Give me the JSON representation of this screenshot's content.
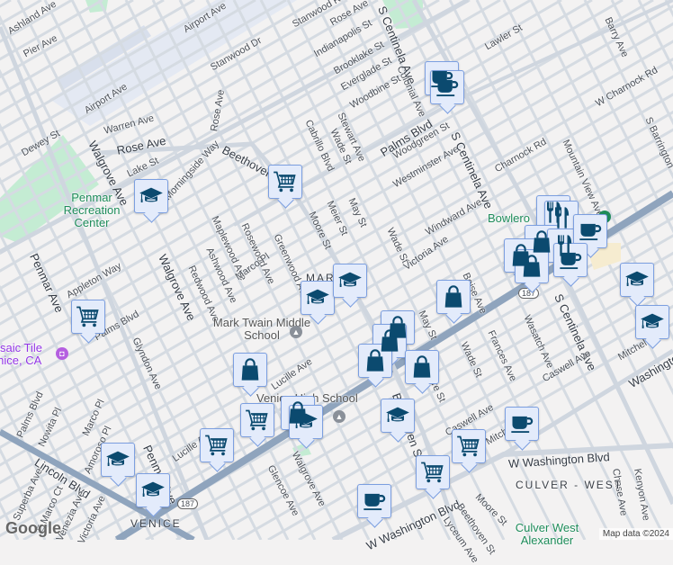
{
  "streets": [
    "Ashland Ave",
    "Pier Ave",
    "Airport Ave",
    "Airport Ave",
    "Stanwood Dr",
    "Stanwood Rd",
    "Warren Ave",
    "Dewey St",
    "Rose Ave",
    "Walgrove Ave",
    "Lake St",
    "Rose Ave",
    "Morningside Way",
    "Beethoven St",
    "Cabrillo Blvd",
    "Maplewood Ave",
    "Rosewood Ave",
    "Greenwood Ave",
    "Ashwood Ave",
    "Redwood Ave",
    "Marco Pl",
    "Meier St",
    "Moore St",
    "May St",
    "Wade St",
    "Victoria Ave",
    "Windward Ave",
    "Westminster Ave",
    "Woodgreen St",
    "Palms Blvd",
    "Charnock Rd",
    "S Centinela Ave",
    "W Charnock Rd",
    "Mountain View Ave",
    "S Barrington",
    "Barry Ave",
    "Lawler St",
    "Colonial Ave",
    "Woodbine St",
    "Everglade St",
    "Brooklake St",
    "Indianapolis St",
    "Rose Ave",
    "Stewart Ave",
    "Wade St",
    "S Centinela Ave",
    "Lucille Ave",
    "Lucille Ave",
    "Palms Blvd",
    "Appleton Way",
    "Glyndon Ave",
    "Palms Blvd",
    "Nowita Pl",
    "Marco Pl",
    "Amoroso Pl",
    "Lincoln Blvd",
    "Superba Ave",
    "E Marco Ct",
    "Venezia Ave",
    "Victoria Ave",
    "Penmar Ave",
    "Penmar Ave",
    "Glencoe Ave",
    "Walgrove Ave",
    "Walgrove Ave",
    "Beethoven St",
    "Moore St",
    "May St",
    "Wade St",
    "Frances Ave",
    "Wasatch Ave",
    "Boise Ave",
    "S Centinela Ave",
    "Caswell Ave",
    "Caswell Ave",
    "Mitchell Ave",
    "W Washington Blvd",
    "Washington Blvd",
    "W Washington Blvd",
    "Chase Ave",
    "Kenyon Ave",
    "Moore St",
    "Beethoven St",
    "Lyceum Ave",
    "Mitchell Ave"
  ],
  "places": {
    "penmar": "Penmar Recreation Center",
    "bowlero": "Bowlero",
    "twain": "Mark Twain Middle School",
    "venice_high": "Venice High School",
    "mosaic": "Mosaic Tile Venice, CA",
    "culver_park": "Culver West Alexander"
  },
  "areas": {
    "mar_vista": "MAR VISTA",
    "venice": "VENICE",
    "culver_west": "CULVER - WEST"
  },
  "shield": "187",
  "google": "Google",
  "credit": "Map data ©2024",
  "colors": {
    "marker_bg": "#e3ebfb",
    "marker_border": "#7c9fe0",
    "icon": "#0b4a6f",
    "highway": "#8fa4bd",
    "park": "#c4ecd3"
  }
}
